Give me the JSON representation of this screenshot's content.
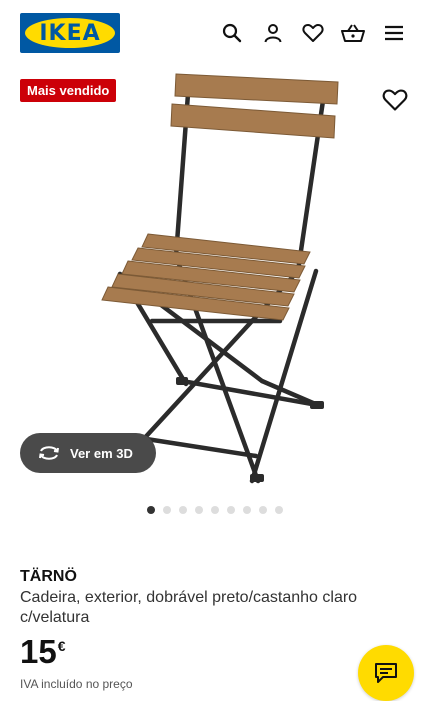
{
  "header": {
    "logo_text": "IKEA",
    "icons": [
      "search-icon",
      "user-icon",
      "heart-icon",
      "basket-icon",
      "menu-icon"
    ]
  },
  "badge": {
    "label": "Mais vendido",
    "color": "#CC0008"
  },
  "gallery": {
    "view3d_label": "Ver em 3D",
    "active_index": 0,
    "total_images": 9
  },
  "product": {
    "name": "TÄRNÖ",
    "description": "Cadeira, exterior, dobrável preto/castanho claro c/velatura",
    "price": "15",
    "currency": "€",
    "vat_note": "IVA incluído no preço"
  },
  "colors": {
    "brand_blue": "#0058A3",
    "brand_yellow": "#FFDB00"
  }
}
